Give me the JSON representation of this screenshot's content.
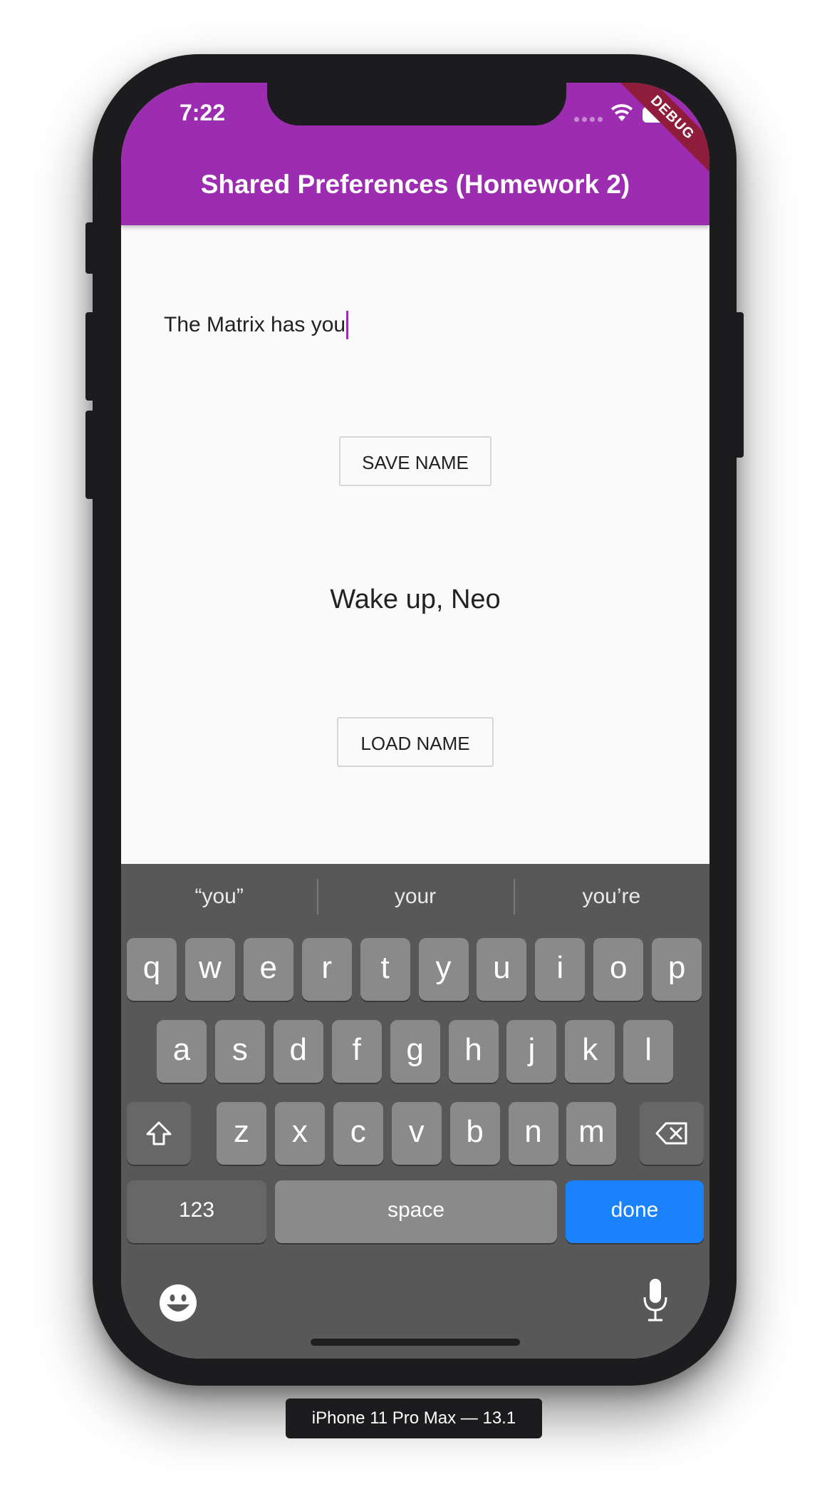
{
  "status_bar": {
    "time": "7:22"
  },
  "debug_banner": "DEBUG",
  "app_bar": {
    "title": "Shared Preferences (Homework 2)"
  },
  "form": {
    "name_value": "The Matrix has you",
    "save_button": "SAVE NAME",
    "greeting": "Wake up, Neo",
    "load_button": "LOAD NAME"
  },
  "keyboard": {
    "suggestions": [
      "“you”",
      "your",
      "you’re"
    ],
    "row1": [
      "q",
      "w",
      "e",
      "r",
      "t",
      "y",
      "u",
      "i",
      "o",
      "p"
    ],
    "row2": [
      "a",
      "s",
      "d",
      "f",
      "g",
      "h",
      "j",
      "k",
      "l"
    ],
    "row3": [
      "z",
      "x",
      "c",
      "v",
      "b",
      "n",
      "m"
    ],
    "numbers_key": "123",
    "space_key": "space",
    "done_key": "done",
    "icons": [
      "shift-icon",
      "backspace-icon",
      "emoji-icon",
      "microphone-icon"
    ],
    "done_color": "#1a82fb"
  },
  "appbar_color": "#9c2db0",
  "simulator_label": "iPhone 11 Pro Max — 13.1"
}
